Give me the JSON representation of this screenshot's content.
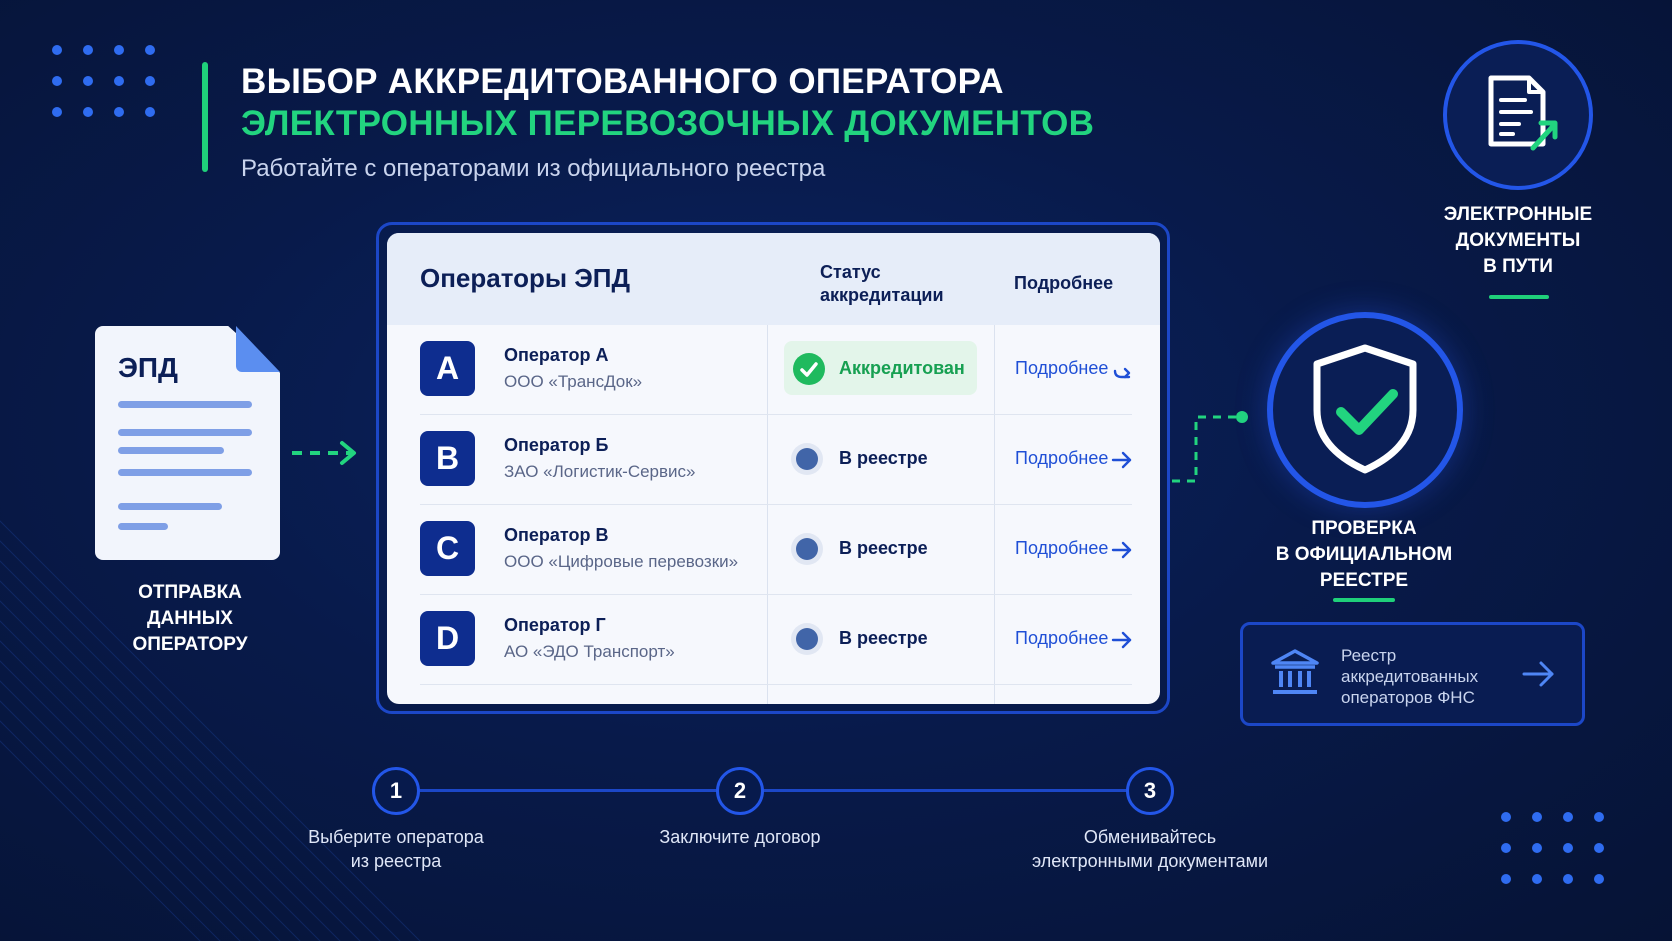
{
  "header": {
    "title_line1": "ВЫБОР АККРЕДИТОВАННОГО ОПЕРАТОРА",
    "title_line2": "ЭЛЕКТРОННЫХ ПЕРЕВОЗОЧНЫХ ДОКУМЕНТОВ",
    "subtitle": "Работайте с операторами из официального реестра"
  },
  "document": {
    "label": "ЭПД",
    "caption_lines": [
      "ОТПРАВКА",
      "ДАННЫХ",
      "ОПЕРАТОРУ"
    ]
  },
  "table": {
    "title": "Операторы ЭПД",
    "col_status_lines": [
      "Статус",
      "аккредитации"
    ],
    "col_more": "Подробнее",
    "rows": [
      {
        "letter": "A",
        "name": "Оператор А",
        "org": "ООО «ТрансДок»",
        "status": "Аккредитован",
        "link": "Подробнее"
      },
      {
        "letter": "B",
        "name": "Оператор Б",
        "org": "ЗАО «Логистик-Сервис»",
        "status": "В реестре",
        "link": "Подробнее"
      },
      {
        "letter": "C",
        "name": "Оператор В",
        "org": "ООО «Цифровые перевозки»",
        "status": "В реестре",
        "link": "Подробнее"
      },
      {
        "letter": "D",
        "name": "Оператор Г",
        "org": "АО «ЭДО Транспорт»",
        "status": "В реестре",
        "link": "Подробнее"
      }
    ]
  },
  "right": {
    "top_caption_lines": [
      "ЭЛЕКТРОННЫЕ",
      "ДОКУМЕНТЫ",
      "В ПУТИ"
    ],
    "shield_caption_lines": [
      "ПРОВЕРКА",
      "В ОФИЦИАЛЬНОМ",
      "РЕЕСТРЕ"
    ],
    "registry_lines": [
      "Реестр",
      "аккредитованных",
      "операторов ФНС"
    ]
  },
  "steps": [
    {
      "number": "1",
      "label_lines": [
        "Выберите оператора",
        "из реестра"
      ]
    },
    {
      "number": "2",
      "label_lines": [
        "Заключите договор"
      ]
    },
    {
      "number": "3",
      "label_lines": [
        "Обменивайтесь",
        "электронными документами"
      ]
    }
  ],
  "colors": {
    "background": "#081a4a",
    "accent_green": "#22d47f",
    "accent_blue": "#2356e8",
    "card_bg": "#f6f8fd",
    "link_blue": "#1f4fd6"
  },
  "icons": [
    "document-icon",
    "arrow-right-icon",
    "checkmark-icon",
    "shield-check-icon",
    "document-export-icon",
    "bank-building-icon"
  ]
}
